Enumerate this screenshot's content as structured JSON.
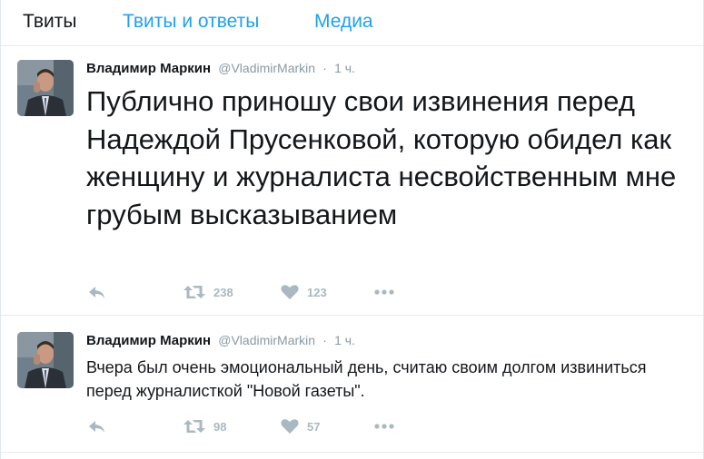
{
  "tabs": [
    {
      "label": "Твиты"
    },
    {
      "label": "Твиты и ответы"
    },
    {
      "label": "Медиа"
    }
  ],
  "tweets": [
    {
      "fullname": "Владимир Маркин",
      "username": "@VladimirMarkin",
      "separator": "·",
      "time": "1 ч.",
      "text": "Публично приношу свои извинения перед Надеждой Прусенковой, которую обидел как женщину и журналиста несвойственным мне грубым высказыванием",
      "retweets": "238",
      "likes": "123"
    },
    {
      "fullname": "Владимир Маркин",
      "username": "@VladimirMarkin",
      "separator": "·",
      "time": "1 ч.",
      "text": "Вчера был очень эмоциональный день, считаю своим долгом извиниться перед журналисткой \"Новой газеты\".",
      "retweets": "98",
      "likes": "57"
    }
  ],
  "icons": {
    "reply": "reply-icon",
    "retweet": "retweet-icon",
    "like": "heart-icon",
    "more": "more-icon"
  },
  "colors": {
    "accent": "#1da1f2",
    "action_gray": "#aab8c2",
    "meta_gray": "#8899a6"
  }
}
